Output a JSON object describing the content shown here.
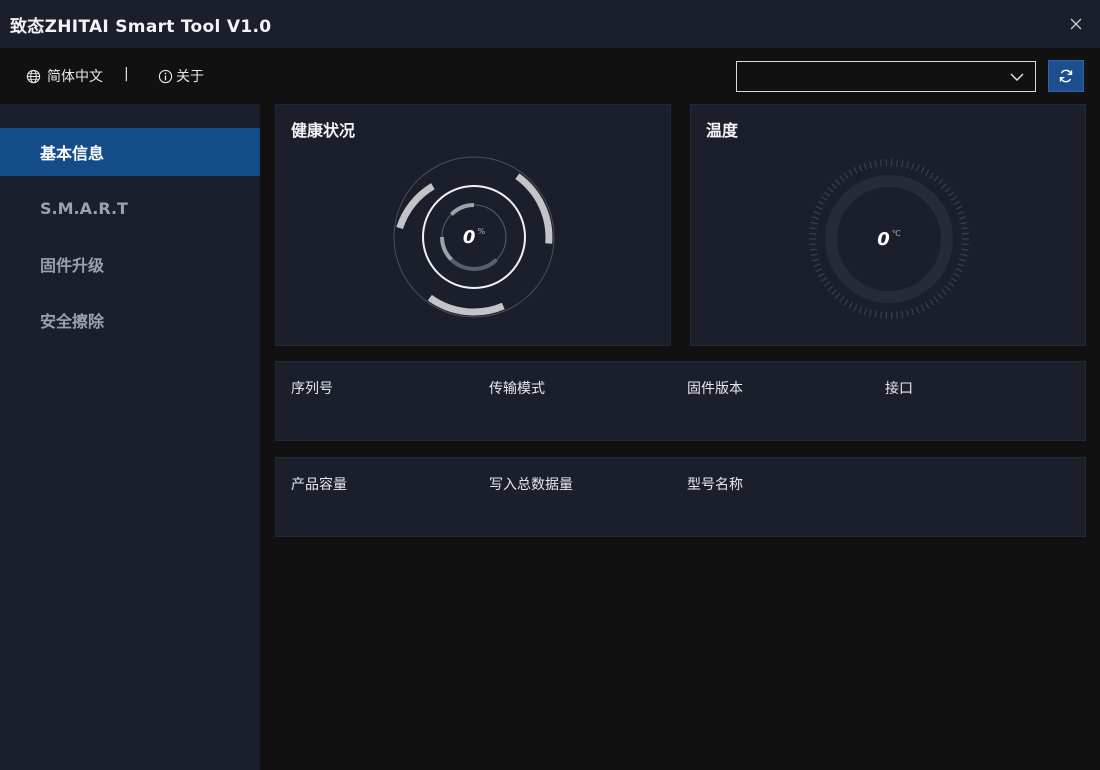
{
  "window": {
    "title": "致态ZHITAI Smart Tool V1.0",
    "close_icon": "close-icon"
  },
  "toolbar": {
    "language_label": "简体中文",
    "separator": "|",
    "about_label": "关于",
    "device_select_value": "",
    "globe_icon": "globe-icon",
    "info_icon": "info-icon",
    "chevron_icon": "chevron-down-icon",
    "refresh_icon": "refresh-icon"
  },
  "sidebar": {
    "items": [
      {
        "label": "基本信息",
        "active": true
      },
      {
        "label": "S.M.A.R.T",
        "active": false
      },
      {
        "label": "固件升级",
        "active": false
      },
      {
        "label": "安全擦除",
        "active": false
      }
    ]
  },
  "health": {
    "title": "健康状况",
    "value": "0",
    "unit": "%"
  },
  "temperature": {
    "title": "温度",
    "value": "0",
    "unit": "℃"
  },
  "info_row_1": {
    "labels": [
      "序列号",
      "传输模式",
      "固件版本",
      "接口"
    ]
  },
  "info_row_2": {
    "labels": [
      "产品容量",
      "写入总数据量",
      "型号名称"
    ]
  },
  "colors": {
    "accent": "#144c8a",
    "refresh_button": "#1d4f8f",
    "panel_bg": "#1b1f2b",
    "page_bg": "#111111"
  }
}
